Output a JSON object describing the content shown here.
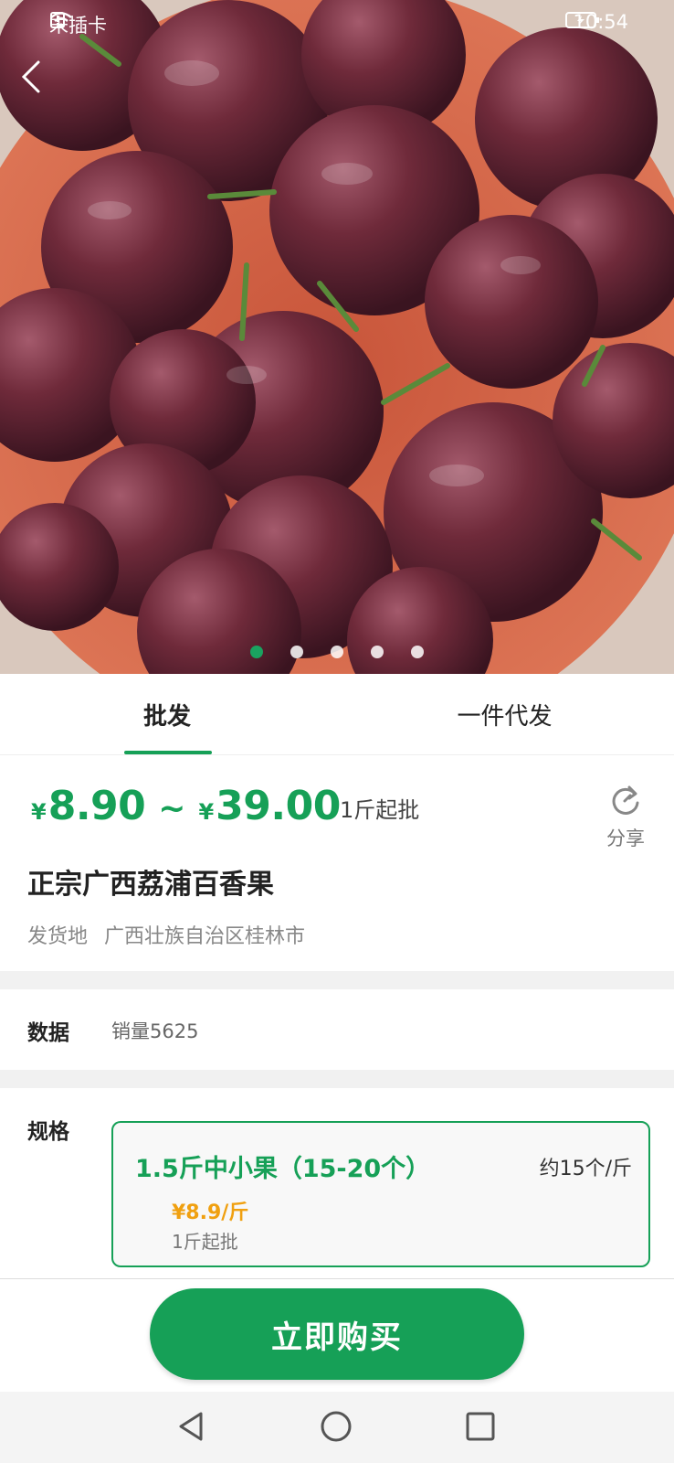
{
  "status_bar": {
    "carrier": "未插卡",
    "time": "10:54"
  },
  "carousel": {
    "total": 5,
    "active_index": 0
  },
  "tabs": [
    {
      "label": "批发",
      "active": true
    },
    {
      "label": "一件代发",
      "active": false
    }
  ],
  "price": {
    "currency": "¥",
    "low": "8.90",
    "high": "39.00",
    "separator": "~",
    "min_order": "1斤起批"
  },
  "share_label": "分享",
  "title": "正宗广西荔浦百香果",
  "shipping": {
    "label": "发货地",
    "value": "广西壮族自治区桂林市"
  },
  "data_section": {
    "label": "数据",
    "value": "销量5625"
  },
  "spec_section": {
    "label": "规格",
    "option": {
      "name": "1.5斤中小果（15-20个）",
      "count": "约15个/斤",
      "price": "¥8.9/斤",
      "min_order": "1斤起批"
    }
  },
  "buy_button": "立即购买",
  "colors": {
    "accent": "#16a057",
    "price_orange": "#f0a010"
  }
}
